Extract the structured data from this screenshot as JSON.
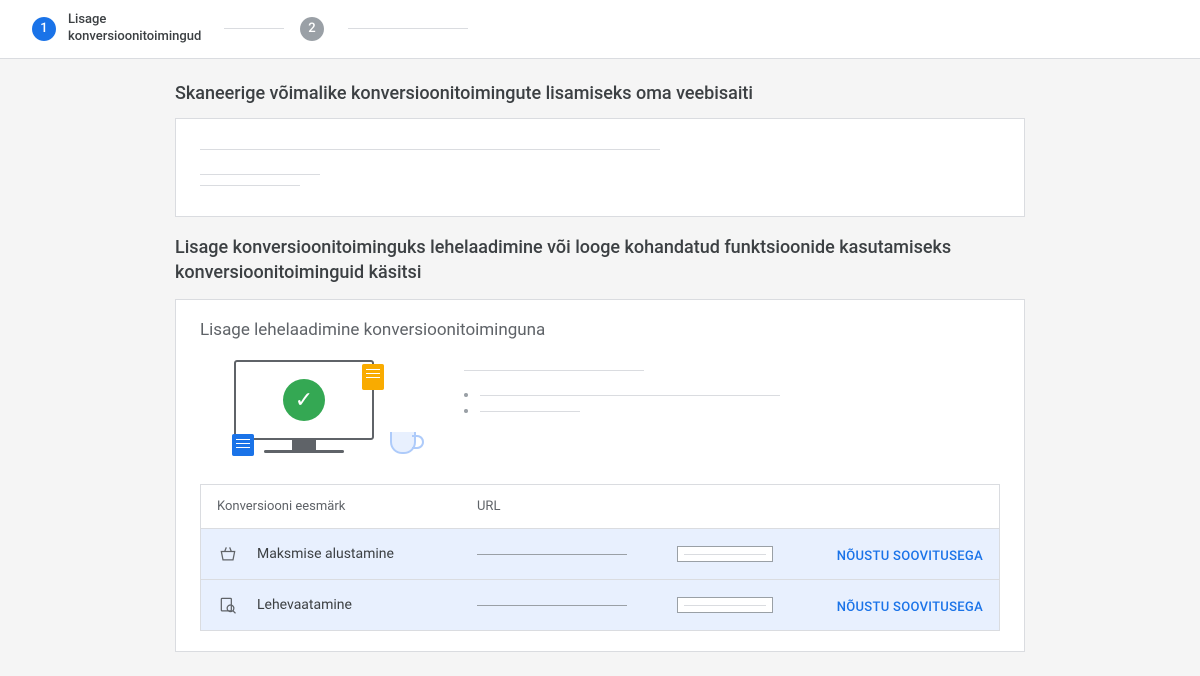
{
  "stepper": {
    "step1": {
      "num": "1",
      "label": "Lisage konversioonitoimingud"
    },
    "step2": {
      "num": "2"
    }
  },
  "headings": {
    "scan": "Skaneerige võimalike konversioonitoimingute lisamiseks oma veebisaiti",
    "manual": "Lisage konversioonitoiminguks lehelaadimine või looge kohandatud funktsioonide kasutamiseks konversioonitoiminguid käsitsi",
    "pageload": "Lisage lehelaadimine konversioonitoiminguna"
  },
  "table": {
    "headers": {
      "goal": "Konversiooni eesmärk",
      "url": "URL"
    },
    "rows": [
      {
        "icon": "basket",
        "label": "Maksmise alustamine",
        "action": "NÕUSTU SOOVITUSEGA"
      },
      {
        "icon": "pageview",
        "label": "Lehevaatamine",
        "action": "NÕUSTU SOOVITUSEGA"
      }
    ]
  }
}
